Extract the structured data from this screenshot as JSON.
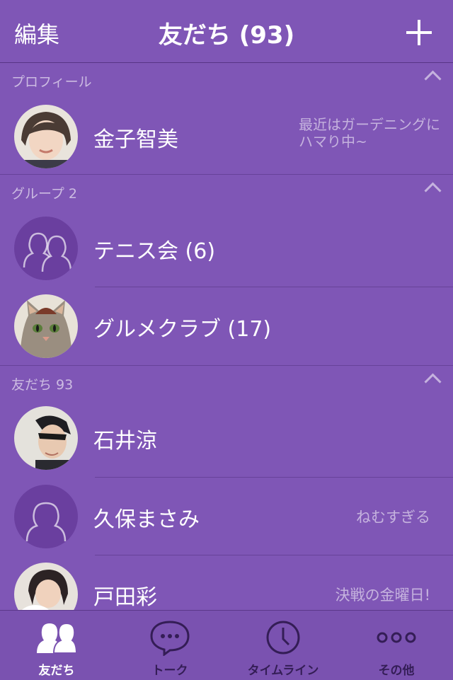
{
  "header": {
    "edit_label": "編集",
    "title": "友だち (93)"
  },
  "sections": {
    "profile": {
      "label": "プロフィール"
    },
    "groups": {
      "label": "グループ 2"
    },
    "friends": {
      "label": "友だち 93"
    }
  },
  "profile": {
    "name": "金子智美",
    "status": "最近はガーデニングにハマり中~"
  },
  "groups": [
    {
      "name": "テニス会 (6)"
    },
    {
      "name": "グルメクラブ (17)"
    }
  ],
  "friends": [
    {
      "name": "石井涼",
      "status": ""
    },
    {
      "name": "久保まさみ",
      "status": "ねむすぎる"
    },
    {
      "name": "戸田彩",
      "status": "決戦の金曜日!"
    }
  ],
  "tabs": [
    {
      "label": "友だち",
      "icon": "friends-icon",
      "active": true
    },
    {
      "label": "トーク",
      "icon": "chat-bubble-icon",
      "active": false
    },
    {
      "label": "タイムライン",
      "icon": "clock-icon",
      "active": false
    },
    {
      "label": "その他",
      "icon": "more-icon",
      "active": false
    }
  ],
  "colors": {
    "background": "#7f56b6",
    "tabbar": "#7a52b0",
    "accent_text": "#ffffff"
  }
}
